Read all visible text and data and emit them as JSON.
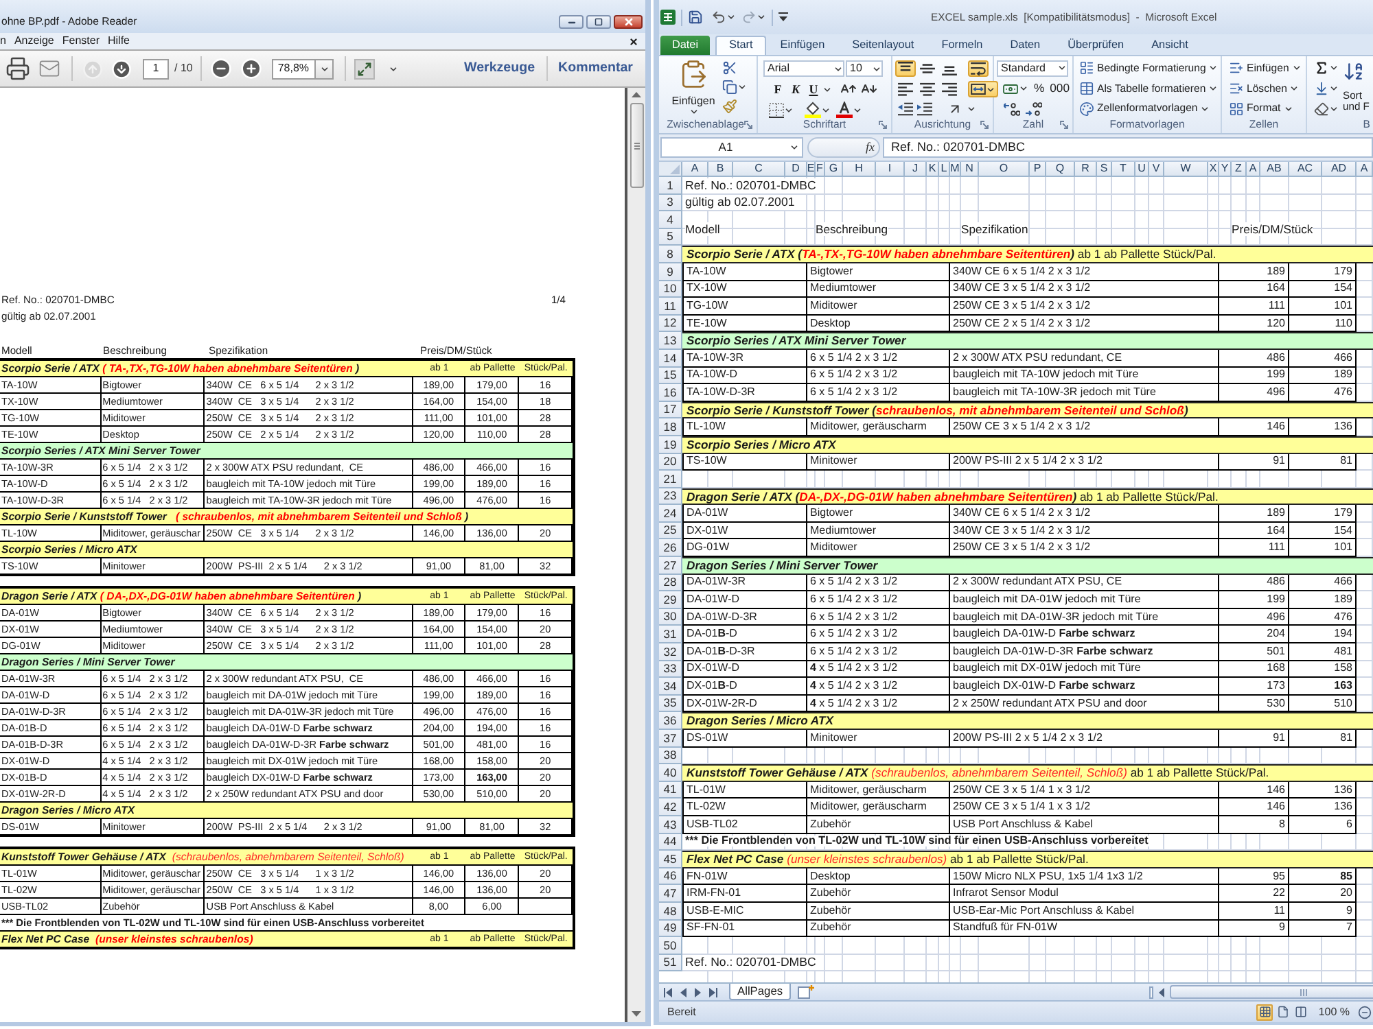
{
  "reader": {
    "title": "ohne BP.pdf - Adobe Reader",
    "menu": [
      "n",
      "Anzeige",
      "Fenster",
      "Hilfe"
    ],
    "toolbar": {
      "nav": [
        {
          "disabled": true
        },
        {
          "disabled": false
        }
      ],
      "page": "1",
      "page_total": "/ 10",
      "zoom": "78,8%",
      "panes": [
        "Werkzeuge",
        "Kommentar"
      ]
    },
    "document": {
      "ref": "Ref. No.: 020701-DMBC",
      "page": "1/4",
      "valid": "gültig ab 02.07.2001",
      "headers": [
        "Modell",
        "Beschreibung",
        "Spezifikation",
        "Preis/DM/Stück"
      ],
      "blocks": [
        {
          "rows": [
            {
              "kind": "section",
              "color": "#ffff99",
              "parts": [
                {
                  "text": "Scorpio Serie / ATX ",
                  "kind": "title"
                },
                {
                  "text": "( TA-,TX-,TG-10W haben abnehmbare Seitentüren",
                  "kind": "note"
                },
                {
                  "text": " )",
                  "kind": "title"
                }
              ],
              "prices": [
                "ab 1",
                "ab Pallette",
                "Stück/Pal."
              ]
            },
            {
              "kind": "item",
              "cells": [
                "TA-10W",
                "Bigtower",
                "340W  CE   6 x 5 1/4      2 x 3 1/2",
                "189,00",
                "179,00",
                "16"
              ]
            },
            {
              "kind": "item",
              "cells": [
                "TX-10W",
                "Mediumtower",
                "340W  CE   3 x 5 1/4      2 x 3 1/2",
                "164,00",
                "154,00",
                "18"
              ]
            },
            {
              "kind": "item",
              "cells": [
                "TG-10W",
                "Miditower",
                "250W  CE   3 x 5 1/4      2 x 3 1/2",
                "111,00",
                "101,00",
                "28"
              ]
            },
            {
              "kind": "item",
              "cells": [
                "TE-10W",
                "Desktop",
                "250W  CE   2 x 5 1/4      2 x 3 1/2",
                "120,00",
                "110,00",
                "28"
              ]
            },
            {
              "kind": "section",
              "color": "#ccffcc",
              "parts": [
                {
                  "text": "Scorpio Series / ATX Mini Server Tower",
                  "kind": "title"
                }
              ]
            },
            {
              "kind": "item",
              "cells": [
                "TA-10W-3R",
                "6 x 5 1/4   2 x 3 1/2",
                "2 x 300W ATX PSU redundant,  CE",
                "486,00",
                "466,00",
                "16"
              ]
            },
            {
              "kind": "item",
              "cells": [
                "TA-10W-D",
                "6 x 5 1/4   2 x 3 1/2",
                "baugleich mit TA-10W jedoch mit Türe",
                "199,00",
                "189,00",
                "16"
              ]
            },
            {
              "kind": "item",
              "cells": [
                "TA-10W-D-3R",
                "6 x 5 1/4   2 x 3 1/2",
                "baugleich mit TA-10W-3R jedoch mit Türe",
                "496,00",
                "476,00",
                "16"
              ]
            },
            {
              "kind": "section",
              "color": "#ffff99",
              "parts": [
                {
                  "text": "Scorpio Serie / Kunststoff Tower   ",
                  "kind": "title"
                },
                {
                  "text": "( schraubenlos, mit abnehmbarem Seitenteil und Schloß",
                  "kind": "note"
                },
                {
                  "text": " )",
                  "kind": "title"
                }
              ]
            },
            {
              "kind": "item",
              "cells": [
                "TL-10W",
                "Miditower, geräuschar",
                "250W  CE   3 x 5 1/4      2 x 3 1/2",
                "146,00",
                "136,00",
                "20"
              ]
            },
            {
              "kind": "section",
              "color": "#ffff99",
              "parts": [
                {
                  "text": "Scorpio Series / Micro ATX",
                  "kind": "title"
                }
              ]
            },
            {
              "kind": "item",
              "cells": [
                "TS-10W",
                "Minitower",
                "200W  PS-III  2 x 5 1/4      2 x 3 1/2",
                "91,00",
                "81,00",
                "32"
              ]
            }
          ]
        },
        {
          "rows": [
            {
              "kind": "section",
              "color": "#ffff99",
              "parts": [
                {
                  "text": "Dragon Serie / ATX ",
                  "kind": "title"
                },
                {
                  "text": "( DA-,DX-,DG-01W haben abnehmbare Seitentüren",
                  "kind": "note"
                },
                {
                  "text": " )",
                  "kind": "title"
                }
              ],
              "prices": [
                "ab 1",
                "ab Pallette",
                "Stück/Pal."
              ]
            },
            {
              "kind": "item",
              "cells": [
                "DA-01W",
                "Bigtower",
                "340W  CE   6 x 5 1/4      2 x 3 1/2",
                "189,00",
                "179,00",
                "16"
              ]
            },
            {
              "kind": "item",
              "cells": [
                "DX-01W",
                "Mediumtower",
                "340W  CE   3 x 5 1/4      2 x 3 1/2",
                "164,00",
                "154,00",
                "20"
              ]
            },
            {
              "kind": "item",
              "cells": [
                "DG-01W",
                "Miditower",
                "250W  CE   3 x 5 1/4      2 x 3 1/2",
                "111,00",
                "101,00",
                "28"
              ]
            },
            {
              "kind": "section",
              "color": "#ccffcc",
              "parts": [
                {
                  "text": "Dragon Series / Mini Server Tower",
                  "kind": "title"
                }
              ]
            },
            {
              "kind": "item",
              "cells": [
                "DA-01W-3R",
                "6 x 5 1/4   2 x 3 1/2",
                "2 x 300W redundant ATX PSU,  CE",
                "486,00",
                "466,00",
                "16"
              ]
            },
            {
              "kind": "item",
              "cells": [
                "DA-01W-D",
                "6 x 5 1/4   2 x 3 1/2",
                "baugleich mit DA-01W jedoch mit Türe",
                "199,00",
                "189,00",
                "16"
              ]
            },
            {
              "kind": "item",
              "cells": [
                "DA-01W-D-3R",
                "6 x 5 1/4   2 x 3 1/2",
                "baugleich mit DA-01W-3R jedoch mit Türe",
                "496,00",
                "476,00",
                "16"
              ]
            },
            {
              "kind": "item",
              "cells": [
                "DA-01B-D",
                "6 x 5 1/4   2 x 3 1/2",
                "baugleich DA-01W-D **Farbe schwarz**",
                "204,00",
                "194,00",
                "16"
              ]
            },
            {
              "kind": "item",
              "cells": [
                "DA-01B-D-3R",
                "6 x 5 1/4   2 x 3 1/2",
                "baugleich DA-01W-D-3R **Farbe schwarz**",
                "501,00",
                "481,00",
                "16"
              ]
            },
            {
              "kind": "item",
              "cells": [
                "DX-01W-D",
                "4 x 5 1/4   2 x 3 1/2",
                "baugleich mit DX-01W jedoch mit Türe",
                "168,00",
                "158,00",
                "20"
              ]
            },
            {
              "kind": "item",
              "cells": [
                "DX-01B-D",
                "4 x 5 1/4   2 x 3 1/2",
                "baugleich DX-01W-D **Farbe schwarz**",
                "173,00",
                "163,00",
                "20"
              ],
              "bold_price": true
            },
            {
              "kind": "item",
              "cells": [
                "DX-01W-2R-D",
                "4 x 5 1/4   2 x 3 1/2",
                "2 x 250W redundant ATX PSU and door",
                "530,00",
                "510,00",
                "20"
              ]
            },
            {
              "kind": "section",
              "color": "#ffff99",
              "parts": [
                {
                  "text": "Dragon Series / Micro ATX",
                  "kind": "title"
                }
              ]
            },
            {
              "kind": "item",
              "cells": [
                "DS-01W",
                "Minitower",
                "200W  PS-III  2 x 5 1/4      2 x 3 1/2",
                "91,00",
                "81,00",
                "32"
              ]
            }
          ]
        },
        {
          "rows": [
            {
              "kind": "section",
              "color": "#ffff99",
              "parts": [
                {
                  "text": "Kunststoff Tower Gehäuse / ATX  ",
                  "kind": "title"
                },
                {
                  "text": "(schraubenlos, abnehmbarem Seitenteil, Schloß)",
                  "kind": "remark"
                }
              ],
              "prices": [
                "ab 1",
                "ab Pallette",
                "Stück/Pal."
              ]
            },
            {
              "kind": "item",
              "cells": [
                "TL-01W",
                "Miditower, geräuschar",
                "250W  CE   3 x 5 1/4      1 x 3 1/2",
                "146,00",
                "136,00",
                "20"
              ]
            },
            {
              "kind": "item",
              "cells": [
                "TL-02W",
                "Miditower, geräuschar",
                "250W  CE   3 x 5 1/4      1 x 3 1/2",
                "146,00",
                "136,00",
                "20"
              ]
            },
            {
              "kind": "item",
              "cells": [
                "USB-TL02",
                "Zubehör",
                "USB Port Anschluss & Kabel",
                "8,00",
                "6,00"
              ]
            },
            {
              "kind": "notice",
              "text": "*** Die Frontblenden von TL-02W und TL-10W sind für einen USB-Anschluss vorbereitet"
            },
            {
              "kind": "section",
              "color": "#ffff99",
              "parts": [
                {
                  "text": "Flex Net PC Case  ",
                  "kind": "title"
                },
                {
                  "text": "(unser kleinstes schraubenlos)",
                  "kind": "note"
                }
              ],
              "prices": [
                "ab 1",
                "ab Pallette",
                "Stück/Pal."
              ]
            }
          ]
        }
      ]
    }
  },
  "excel": {
    "title": "EXCEL sample.xls  [Kompatibilitätsmodus]  -  Microsoft Excel",
    "tabs": [
      {
        "label": "Datei",
        "kind": "file",
        "selected": false
      },
      {
        "label": "Start",
        "kind": "tab",
        "selected": true
      },
      {
        "label": "Einfügen",
        "kind": "tab",
        "selected": false
      },
      {
        "label": "Seitenlayout",
        "kind": "tab",
        "selected": false
      },
      {
        "label": "Formeln",
        "kind": "tab",
        "selected": false
      },
      {
        "label": "Daten",
        "kind": "tab",
        "selected": false
      },
      {
        "label": "Überprüfen",
        "kind": "tab",
        "selected": false
      },
      {
        "label": "Ansicht",
        "kind": "tab",
        "selected": false
      }
    ],
    "ribbon": {
      "clipboard": {
        "paste": "Einfügen",
        "label": "Zwischenablage"
      },
      "font": {
        "name": "Arial",
        "size": "10",
        "styles": [
          "F",
          "K",
          "U"
        ],
        "label": "Schriftart"
      },
      "alignment": {
        "buttons": [
          {
            "selected": true
          },
          {
            "selected": false
          },
          {
            "selected": false
          },
          {
            "selected": true
          },
          {
            "selected": false
          },
          {
            "selected": false
          },
          {
            "selected": false
          },
          {
            "selected": true
          }
        ],
        "label": "Ausrichtung"
      },
      "number": {
        "format": "Standard",
        "symbols": [
          "%",
          "000"
        ],
        "label": "Zahl"
      },
      "styles": {
        "commands": [
          "Bedingte Formatierung",
          "Als Tabelle formatieren",
          "Zellenformatvorlagen"
        ],
        "label": "Formatvorlagen"
      },
      "cells": {
        "commands": [
          "Einfügen",
          "Löschen",
          "Format"
        ],
        "label": "Zellen"
      },
      "editing": {
        "sort": [
          "Sort",
          "und F"
        ],
        "label": "B"
      }
    },
    "formula_bar": {
      "cell": "A1",
      "fx": "fx",
      "value": "Ref. No.: 020701-DMBC"
    },
    "columns": [
      "A",
      "B",
      "C",
      "D",
      "E",
      "F",
      "G",
      "H",
      "I",
      "J",
      "K",
      "L",
      "M",
      "N",
      "O",
      "P",
      "Q",
      "R",
      "S",
      "T",
      "U",
      "V",
      "W",
      "X",
      "Y",
      "Z",
      "A",
      "AB",
      "AC",
      "AD",
      "A"
    ],
    "rows": [
      {
        "number": "1",
        "kind": "text",
        "text": "Ref. No.: 020701-DMBC"
      },
      {
        "number": "3",
        "kind": "text",
        "text": "gültig ab 02.07.2001"
      },
      {
        "number": "4",
        "kind": "empty"
      },
      {
        "number": "5",
        "kind": "headers",
        "cells": [
          "Modell",
          "Beschreibung",
          "Spezifikation",
          "Preis/DM/Stück"
        ]
      },
      {
        "number": "8",
        "kind": "section",
        "color": "#ffff99",
        "parts": [
          {
            "text": "Scorpio Serie / ATX (",
            "kind": "title"
          },
          {
            "text": "TA-,TX-,TG-10W haben abnehmbare Seitentüren",
            "kind": "note"
          },
          {
            "text": ")",
            "kind": "title"
          },
          {
            "text": " ab 1 ab Pallette Stück/Pal.",
            "kind": "plain"
          }
        ]
      },
      {
        "number": "9",
        "kind": "item",
        "cells": [
          "TA-10W",
          "Bigtower",
          "340W CE 6 x 5 1/4 2 x 3 1/2",
          "189",
          "179"
        ]
      },
      {
        "number": "10",
        "kind": "item",
        "cells": [
          "TX-10W",
          "Mediumtower",
          "340W CE 3 x 5 1/4 2 x 3 1/2",
          "164",
          "154"
        ]
      },
      {
        "number": "11",
        "kind": "item",
        "cells": [
          "TG-10W",
          "Miditower",
          "250W CE 3 x 5 1/4 2 x 3 1/2",
          "111",
          "101"
        ]
      },
      {
        "number": "12",
        "kind": "item",
        "cells": [
          "TE-10W",
          "Desktop",
          "250W CE 2 x 5 1/4 2 x 3 1/2",
          "120",
          "110"
        ]
      },
      {
        "number": "13",
        "kind": "section",
        "color": "#ccffcc",
        "parts": [
          {
            "text": "Scorpio Series / ATX Mini Server Tower",
            "kind": "title"
          }
        ]
      },
      {
        "number": "14",
        "kind": "item",
        "cells": [
          "TA-10W-3R",
          "6 x 5 1/4 2 x 3 1/2",
          "2 x 300W ATX PSU redundant, CE",
          "486",
          "466"
        ]
      },
      {
        "number": "15",
        "kind": "item",
        "cells": [
          "TA-10W-D",
          "6 x 5 1/4 2 x 3 1/2",
          "baugleich mit TA-10W jedoch mit Türe",
          "199",
          "189"
        ]
      },
      {
        "number": "16",
        "kind": "item",
        "cells": [
          "TA-10W-D-3R",
          "6 x 5 1/4 2 x 3 1/2",
          "baugleich mit TA-10W-3R jedoch mit Türe",
          "496",
          "476"
        ]
      },
      {
        "number": "17",
        "kind": "section",
        "color": "#ffff99",
        "parts": [
          {
            "text": "Scorpio Serie / Kunststoff Tower (",
            "kind": "title"
          },
          {
            "text": "schraubenlos, mit abnehmbarem Seitenteil und Schloß",
            "kind": "note"
          },
          {
            "text": ")",
            "kind": "title"
          }
        ]
      },
      {
        "number": "18",
        "kind": "item",
        "cells": [
          "TL-10W",
          "Miditower, geräuscharm",
          "250W CE 3 x 5 1/4 2 x 3 1/2",
          "146",
          "136"
        ]
      },
      {
        "number": "19",
        "kind": "section",
        "color": "#ffff99",
        "parts": [
          {
            "text": "Scorpio Series / Micro ATX",
            "kind": "title"
          }
        ]
      },
      {
        "number": "20",
        "kind": "item",
        "cells": [
          "TS-10W",
          "Minitower",
          "200W PS-III 2 x 5 1/4 2 x 3 1/2",
          "91",
          "81"
        ]
      },
      {
        "number": "21",
        "kind": "empty"
      },
      {
        "number": "23",
        "kind": "section",
        "color": "#ffff99",
        "parts": [
          {
            "text": "Dragon Serie / ATX (",
            "kind": "title"
          },
          {
            "text": "DA-,DX-,DG-01W haben abnehmbare Seitentüren",
            "kind": "note"
          },
          {
            "text": ")",
            "kind": "title"
          },
          {
            "text": " ab 1 ab Pallette Stück/Pal.",
            "kind": "plain"
          }
        ]
      },
      {
        "number": "24",
        "kind": "item",
        "cells": [
          "DA-01W",
          "Bigtower",
          "340W CE 6 x 5 1/4 2 x 3 1/2",
          "189",
          "179"
        ]
      },
      {
        "number": "25",
        "kind": "item",
        "cells": [
          "DX-01W",
          "Mediumtower",
          "340W CE 3 x 5 1/4 2 x 3 1/2",
          "164",
          "154"
        ]
      },
      {
        "number": "26",
        "kind": "item",
        "cells": [
          "DG-01W",
          "Miditower",
          "250W CE 3 x 5 1/4 2 x 3 1/2",
          "111",
          "101"
        ]
      },
      {
        "number": "27",
        "kind": "section",
        "color": "#ccffcc",
        "parts": [
          {
            "text": "Dragon Series / Mini Server Tower",
            "kind": "title"
          }
        ]
      },
      {
        "number": "28",
        "kind": "item",
        "cells": [
          "DA-01W-3R",
          "6 x 5 1/4 2 x 3 1/2",
          "2 x 300W redundant ATX PSU, CE",
          "486",
          "466"
        ]
      },
      {
        "number": "29",
        "kind": "item",
        "cells": [
          "DA-01W-D",
          "6 x 5 1/4 2 x 3 1/2",
          "baugleich mit DA-01W jedoch mit Türe",
          "199",
          "189"
        ]
      },
      {
        "number": "30",
        "kind": "item",
        "cells": [
          "DA-01W-D-3R",
          "6 x 5 1/4 2 x 3 1/2",
          "baugleich mit DA-01W-3R jedoch mit Türe",
          "496",
          "476"
        ]
      },
      {
        "number": "31",
        "kind": "item",
        "cells": [
          "DA-01**B**-D",
          "6 x 5 1/4 2 x 3 1/2",
          "baugleich DA-01W-D **Farbe schwarz**",
          "204",
          "194"
        ]
      },
      {
        "number": "32",
        "kind": "item",
        "cells": [
          "DA-01**B**-D-3R",
          "6 x 5 1/4 2 x 3 1/2",
          "baugleich DA-01W-D-3R **Farbe schwarz**",
          "501",
          "481"
        ]
      },
      {
        "number": "33",
        "kind": "item",
        "cells": [
          "DX-01W-D",
          "**4** x 5 1/4 2 x 3 1/2",
          "baugleich mit DX-01W jedoch mit Türe",
          "168",
          "158"
        ]
      },
      {
        "number": "34",
        "kind": "item",
        "cells": [
          "DX-01**B**-D",
          "**4** x 5 1/4 2 x 3 1/2",
          "baugleich DX-01W-D **Farbe schwarz**",
          "173",
          "163"
        ],
        "bold_price": true
      },
      {
        "number": "35",
        "kind": "item",
        "cells": [
          "DX-01W-2R-D",
          "**4** x 5 1/4 2 x 3 1/2",
          "2 x 250W redundant ATX PSU and door",
          "530",
          "510"
        ]
      },
      {
        "number": "36",
        "kind": "section",
        "color": "#ffff99",
        "parts": [
          {
            "text": "Dragon Series / Micro ATX",
            "kind": "title"
          }
        ]
      },
      {
        "number": "37",
        "kind": "item",
        "cells": [
          "DS-01W",
          "Minitower",
          "200W PS-III 2 x 5 1/4 2 x 3 1/2",
          "91",
          "81"
        ]
      },
      {
        "number": "38",
        "kind": "empty"
      },
      {
        "number": "40",
        "kind": "section",
        "color": "#ffff99",
        "parts": [
          {
            "text": "Kunststoff Tower Gehäuse / ATX ",
            "kind": "title"
          },
          {
            "text": "(schraubenlos, abnehmbarem Seitenteil, Schloß)",
            "kind": "remark"
          },
          {
            "text": " ab 1 ab Pallette Stück/Pal.",
            "kind": "plain"
          }
        ]
      },
      {
        "number": "41",
        "kind": "item",
        "cells": [
          "TL-01W",
          "Miditower, geräuscharm",
          "250W CE 3 x 5 1/4 1 x 3 1/2",
          "146",
          "136"
        ]
      },
      {
        "number": "42",
        "kind": "item",
        "cells": [
          "TL-02W",
          "Miditower, geräuscharm",
          "250W CE 3 x 5 1/4 1 x 3 1/2",
          "146",
          "136"
        ]
      },
      {
        "number": "43",
        "kind": "item",
        "cells": [
          "USB-TL02",
          "Zubehör",
          "USB Port Anschluss & Kabel",
          "8",
          "6"
        ]
      },
      {
        "number": "44",
        "kind": "notice",
        "text": "*** Die Frontblenden von TL-02W und TL-10W sind für einen USB-Anschluss vorbereitet"
      },
      {
        "number": "45",
        "kind": "section",
        "color": "#ffff99",
        "parts": [
          {
            "text": "Flex Net PC Case ",
            "kind": "title"
          },
          {
            "text": "(unser kleinstes schraubenlos)",
            "kind": "remark"
          },
          {
            "text": " ab 1 ab Pallette Stück/Pal.",
            "kind": "plain"
          }
        ]
      },
      {
        "number": "46",
        "kind": "item",
        "cells": [
          "FN-01W",
          "Desktop",
          "150W Micro NLX PSU, 1x5 1/4 1x3 1/2",
          "95",
          "85"
        ],
        "bold_price": true
      },
      {
        "number": "47",
        "kind": "item",
        "cells": [
          "IRM-FN-01",
          "Zubehör",
          "Infrarot Sensor Modul",
          "22",
          "20"
        ]
      },
      {
        "number": "48",
        "kind": "item",
        "cells": [
          "USB-E-MIC",
          "Zubehör",
          "USB-Ear-Mic Port Anschluss & Kabel",
          "11",
          "9"
        ]
      },
      {
        "number": "49",
        "kind": "item",
        "cells": [
          "SF-FN-01",
          "Zubehör",
          "Standfuß für FN-01W",
          "9",
          "7"
        ]
      },
      {
        "number": "50",
        "kind": "empty"
      },
      {
        "number": "51",
        "kind": "text",
        "text": "Ref. No.: 020701-DMBC"
      }
    ],
    "sheet_tabs": [
      {
        "label": "AllPages",
        "selected": true
      }
    ],
    "status": "Bereit",
    "views": [
      {
        "selected": true
      },
      {
        "selected": false
      },
      {
        "selected": false
      }
    ],
    "zoom": "100 %"
  }
}
